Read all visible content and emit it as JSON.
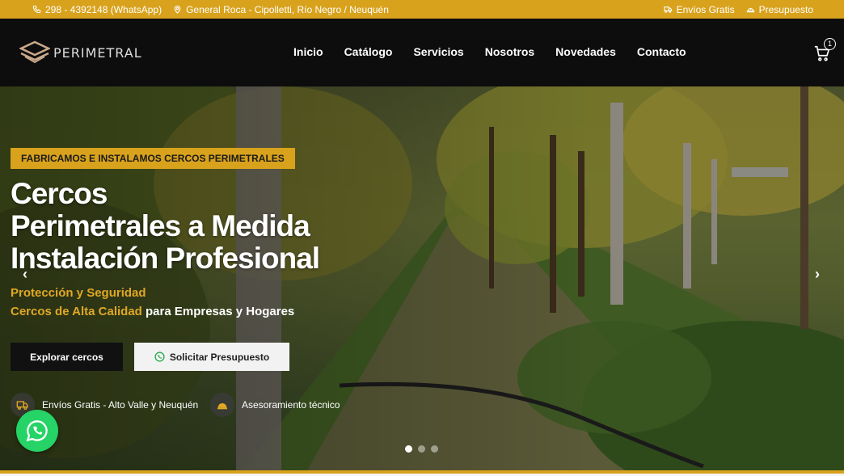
{
  "topbar": {
    "phone": "298 - 4392148 (WhatsApp)",
    "location": "General Roca - Cipolletti, Río Negro / Neuquén",
    "shipping": "Envíos Gratis",
    "quote": "Presupuesto"
  },
  "header": {
    "logo_text": "PERIMETRAL",
    "nav": [
      "Inicio",
      "Catálogo",
      "Servicios",
      "Nosotros",
      "Novedades",
      "Contacto"
    ],
    "cart_count": "1"
  },
  "hero": {
    "badge": "FABRICAMOS E INSTALAMOS CERCOS PERIMETRALES",
    "title_lines": [
      "Cercos",
      "Perimetrales a Medida",
      "Instalación Profesional"
    ],
    "subtitle_line1": "Protección y Seguridad",
    "subtitle_line2_highlight": "Cercos de Alta Calidad",
    "subtitle_line2_rest": " para Empresas y Hogares",
    "btn_explore": "Explorar cercos",
    "btn_quote": "Solicitar Presupuesto",
    "feature1": "Envíos Gratis - Alto Valle y Neuquén",
    "feature2": "Asesoramiento técnico",
    "prev_arrow": "‹",
    "next_arrow": "›",
    "slides": 3,
    "active_slide": 1
  },
  "colors": {
    "accent": "#d8a21c",
    "header_bg": "#0d0d0d",
    "whatsapp": "#25d366"
  },
  "icons": {
    "phone": "phone-icon",
    "location": "map-pin-icon",
    "truck": "truck-icon",
    "helmet": "hard-hat-icon",
    "cart": "cart-icon",
    "whatsapp": "whatsapp-icon"
  }
}
